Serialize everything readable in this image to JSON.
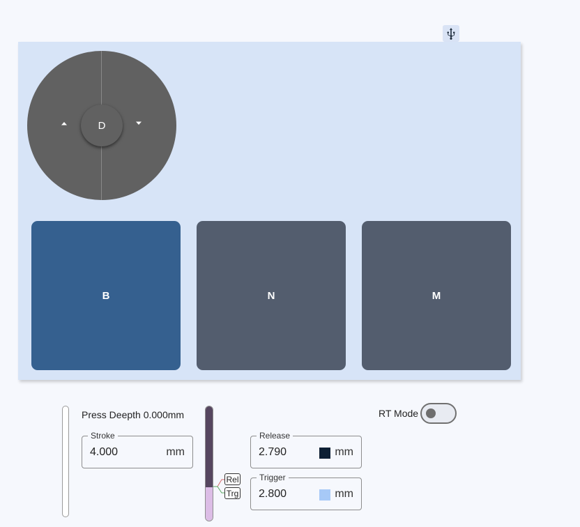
{
  "header": {
    "usb_icon": "usb-icon"
  },
  "dial": {
    "center_label": "D",
    "left_icon": "caret-up-icon",
    "right_icon": "caret-down-icon"
  },
  "keys": [
    {
      "label": "B",
      "active": true
    },
    {
      "label": "N",
      "active": false
    },
    {
      "label": "M",
      "active": false
    }
  ],
  "settings": {
    "press_depth": "Press Deepth 0.000mm",
    "stroke": {
      "label": "Stroke",
      "value": "4.000",
      "unit": "mm"
    },
    "release": {
      "label": "Release",
      "value": "2.790",
      "unit": "mm",
      "swatch_color": "#0d1f33"
    },
    "trigger": {
      "label": "Trigger",
      "value": "2.800",
      "unit": "mm",
      "swatch_color": "#a7c9f7"
    },
    "rel_tag": "Rel",
    "trg_tag": "Trg",
    "meter": {
      "release_fraction": 0.7
    },
    "rt_mode": {
      "label": "RT Mode",
      "enabled": false
    }
  },
  "colors": {
    "panel_bg": "#d7e4f7",
    "key_active": "#35608f",
    "key_default": "#535d6e",
    "dial_bg": "#616161",
    "meter_upper": "#56465f",
    "meter_lower": "#dcbde6"
  }
}
